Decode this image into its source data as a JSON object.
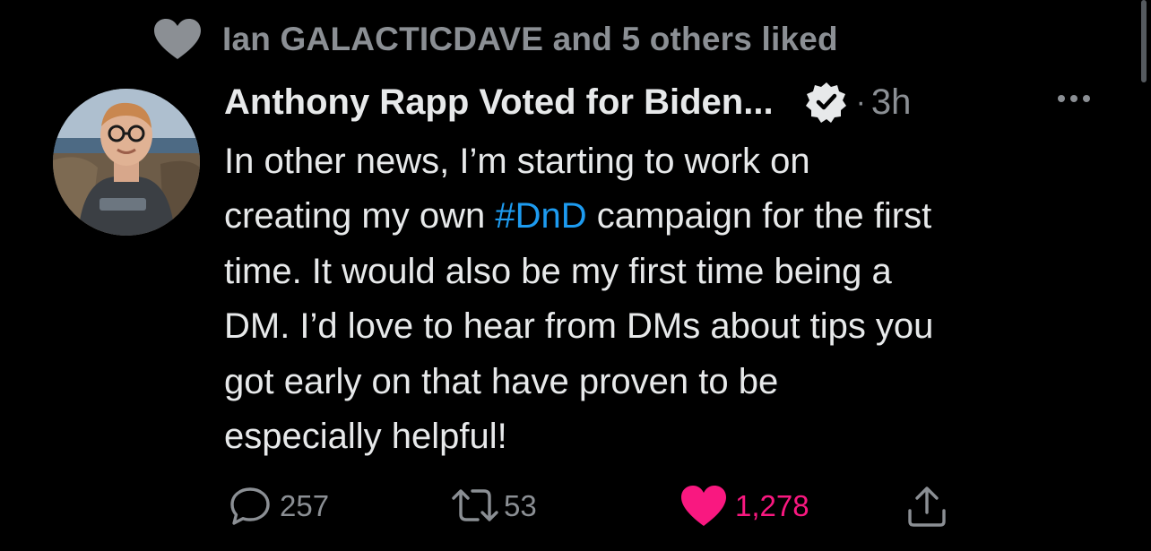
{
  "social_context": {
    "icon": "heart-icon",
    "text": "Ian GALACTICDAVE and 5 others liked"
  },
  "tweet": {
    "display_name": "Anthony Rapp Voted for Biden...",
    "verified_icon": "verified-badge-icon",
    "separator": "·",
    "time": "3h",
    "more_icon": "more-icon",
    "text_lines": [
      {
        "before": "In other news, I’m starting to work on"
      },
      {
        "before": "creating my own ",
        "hashtag": "#DnD",
        "after": " campaign for the first"
      },
      {
        "before": "time. It would also be my first time being a"
      },
      {
        "before": "DM. I’d love to hear from DMs about tips you"
      },
      {
        "before": "got early on that have proven to be"
      },
      {
        "before": "especially helpful!"
      }
    ]
  },
  "actions": {
    "replies": "257",
    "retweets": "53",
    "likes": "1,278",
    "icons": [
      "reply-icon",
      "retweet-icon",
      "heart-filled-icon",
      "share-icon"
    ]
  },
  "colors": {
    "background": "#000000",
    "text": "#e7e9ea",
    "secondary": "#8b8f94",
    "hashtag": "#1d9bf0",
    "like": "#f91880"
  }
}
